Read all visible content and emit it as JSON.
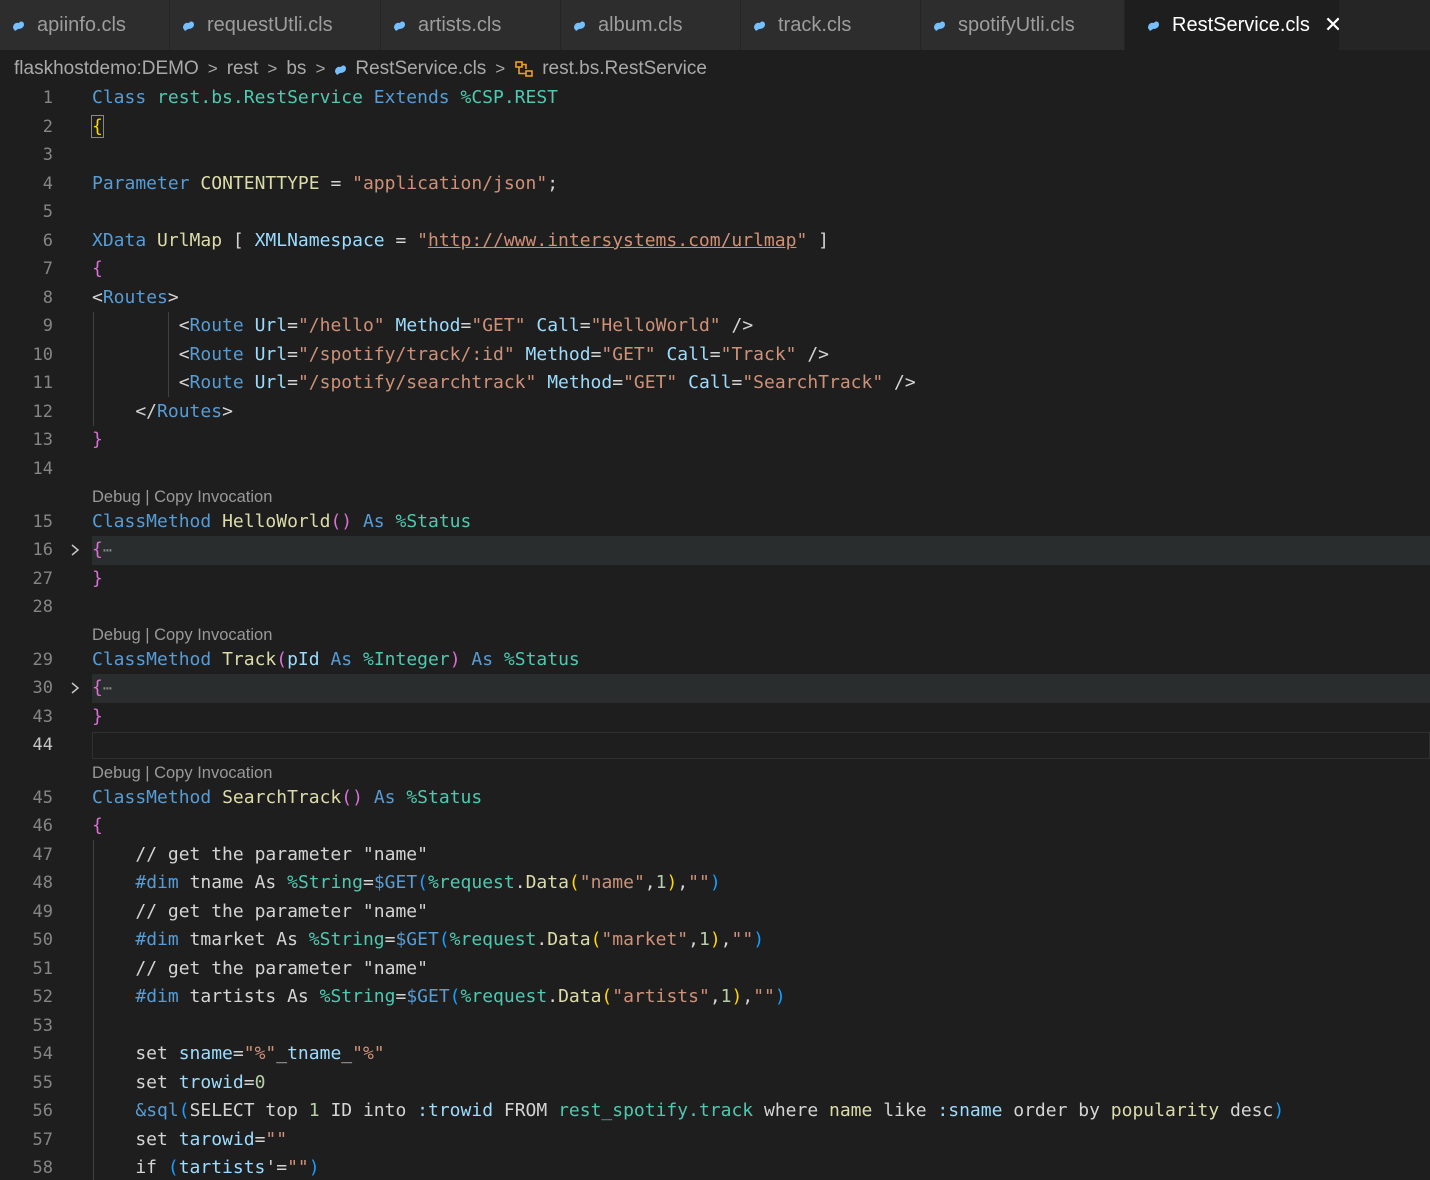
{
  "tabs": [
    {
      "label": "apiinfo.cls",
      "active": false
    },
    {
      "label": "requestUtli.cls",
      "active": false
    },
    {
      "label": "artists.cls",
      "active": false
    },
    {
      "label": "album.cls",
      "active": false
    },
    {
      "label": "track.cls",
      "active": false
    },
    {
      "label": "spotifyUtli.cls",
      "active": false
    },
    {
      "label": "RestService.cls",
      "active": true
    }
  ],
  "breadcrumb": [
    "flaskhostdemo:DEMO",
    "rest",
    "bs",
    "RestService.cls",
    "rest.bs.RestService"
  ],
  "codelens": {
    "debug": "Debug",
    "sep": " | ",
    "copy": "Copy Invocation"
  },
  "lines": [
    {
      "n": "1",
      "text": "Class rest.bs.RestService Extends %CSP.REST"
    },
    {
      "n": "2",
      "text": "{"
    },
    {
      "n": "3",
      "text": ""
    },
    {
      "n": "4",
      "text": "Parameter CONTENTTYPE = \"application/json\";"
    },
    {
      "n": "5",
      "text": ""
    },
    {
      "n": "6",
      "text": "XData UrlMap [ XMLNamespace = \"http://www.intersystems.com/urlmap\" ]"
    },
    {
      "n": "7",
      "text": "{"
    },
    {
      "n": "8",
      "text": "<Routes>"
    },
    {
      "n": "9",
      "text": "\t<Route Url=\"/hello\" Method=\"GET\" Call=\"HelloWorld\" />"
    },
    {
      "n": "10",
      "text": "\t<Route Url=\"/spotify/track/:id\" Method=\"GET\" Call=\"Track\" />"
    },
    {
      "n": "11",
      "text": "\t<Route Url=\"/spotify/searchtrack\" Method=\"GET\" Call=\"SearchTrack\" />"
    },
    {
      "n": "12",
      "text": "</Routes>"
    },
    {
      "n": "13",
      "text": "}"
    },
    {
      "n": "14",
      "text": ""
    },
    {
      "n": "15",
      "text": "ClassMethod HelloWorld() As %Status"
    },
    {
      "n": "16",
      "text": "{…"
    },
    {
      "n": "27",
      "text": "}"
    },
    {
      "n": "28",
      "text": ""
    },
    {
      "n": "29",
      "text": "ClassMethod Track(pId As %Integer) As %Status"
    },
    {
      "n": "30",
      "text": "{…"
    },
    {
      "n": "43",
      "text": "}"
    },
    {
      "n": "44",
      "text": ""
    },
    {
      "n": "45",
      "text": "ClassMethod SearchTrack() As %Status"
    },
    {
      "n": "46",
      "text": "{"
    },
    {
      "n": "47",
      "text": "// get the parameter \"name\""
    },
    {
      "n": "48",
      "text": "#dim tname As %String=$GET(%request.Data(\"name\",1),\"\")"
    },
    {
      "n": "49",
      "text": "// get the parameter \"name\""
    },
    {
      "n": "50",
      "text": "#dim tmarket As %String=$GET(%request.Data(\"market\",1),\"\")"
    },
    {
      "n": "51",
      "text": "// get the parameter \"name\""
    },
    {
      "n": "52",
      "text": "#dim tartists As %String=$GET(%request.Data(\"artists\",1),\"\")"
    },
    {
      "n": "53",
      "text": ""
    },
    {
      "n": "54",
      "text": "set sname=\"%\"_tname_\"%\""
    },
    {
      "n": "55",
      "text": "set trowid=0"
    },
    {
      "n": "56",
      "text": "&sql(SELECT top 1 ID into :trowid FROM rest_spotify.track where name like :sname order by popularity desc)"
    },
    {
      "n": "57",
      "text": "set tarowid=\"\""
    },
    {
      "n": "58",
      "text": "if (tartists'=\"\")"
    }
  ],
  "colors": {
    "background": "#1e1e1e",
    "keyword": "#569cd6",
    "type": "#4ec9b0",
    "string": "#ce9178",
    "function": "#dcdcaa",
    "variable": "#9cdcfe",
    "comment": "#6a9955",
    "number": "#b5cea8",
    "bracket_gold": "#ffd700",
    "bracket_orchid": "#da70d6",
    "bracket_blue": "#179fff"
  },
  "icons": {
    "tab_file": "blue-cloud-file-icon",
    "breadcrumb_class": "class-symbol-icon",
    "fold": "chevron-right-icon",
    "close": "close-icon"
  }
}
